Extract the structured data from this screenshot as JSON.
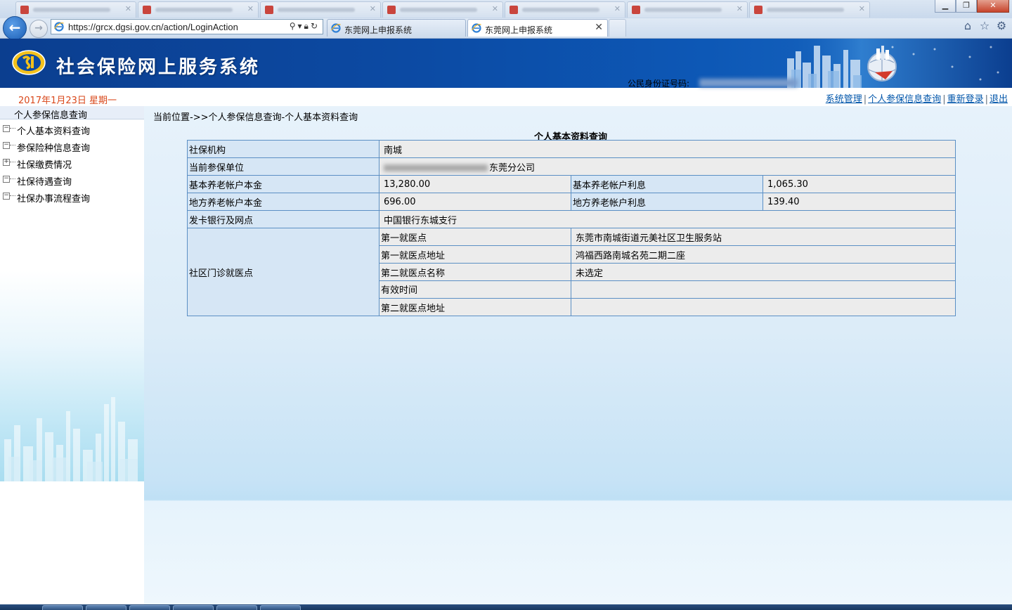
{
  "browser": {
    "url": "https://grcx.dgsi.gov.cn/action/LoginAction",
    "tabs": [
      {
        "label": "东莞网上申报系统",
        "active": false
      },
      {
        "label": "东莞网上申报系统",
        "active": true
      }
    ]
  },
  "banner": {
    "title": "社会保险网上服务系统",
    "id_label": "公民身份证号码:"
  },
  "header": {
    "date": "2017年1月23日  星期一",
    "links": [
      "系统管理",
      "个人参保信息查询",
      "重新登录",
      "退出"
    ]
  },
  "sidebar": {
    "header": "个人参保信息查询",
    "items": [
      {
        "label": "个人基本资料查询",
        "expander": "−"
      },
      {
        "label": "参保险种信息查询",
        "expander": "−"
      },
      {
        "label": "社保缴费情况",
        "expander": "+"
      },
      {
        "label": "社保待遇查询",
        "expander": "−"
      },
      {
        "label": "社保办事流程查询",
        "expander": "−"
      }
    ]
  },
  "main": {
    "breadcrumb": "当前位置->>个人参保信息查询-个人基本资料查询",
    "table_title": "个人基本资料查询",
    "rows": {
      "agency_label": "社保机构",
      "agency_value": "南城",
      "employer_label": "当前参保单位",
      "employer_value": "东莞分公司",
      "basic_principal_label": "基本养老帐户本金",
      "basic_principal_value": "13,280.00",
      "basic_interest_label": "基本养老帐户利息",
      "basic_interest_value": "1,065.30",
      "local_principal_label": "地方养老帐户本金",
      "local_principal_value": "696.00",
      "local_interest_label": "地方养老帐户利息",
      "local_interest_value": "139.40",
      "bank_label": "发卡银行及网点",
      "bank_value": "中国银行东城支行",
      "clinic_label": "社区门诊就医点",
      "clinic": {
        "first_label": "第一就医点",
        "first_value": "东莞市南城街道元美社区卫生服务站",
        "first_addr_label": "第一就医点地址",
        "first_addr_value": "鸿福西路南城名苑二期二座",
        "second_name_label": "第二就医点名称",
        "second_name_value": "未选定",
        "valid_label": "有效时间",
        "valid_value": "",
        "second_addr_label": "第二就医点地址",
        "second_addr_value": ""
      }
    }
  },
  "colors": {
    "banner": "#0c4aa3",
    "date_text": "#d9471a",
    "link": "#0055aa",
    "label_cell": "#d6e6f5",
    "value_cell": "#ececec",
    "table_border": "#5b8fc4"
  }
}
